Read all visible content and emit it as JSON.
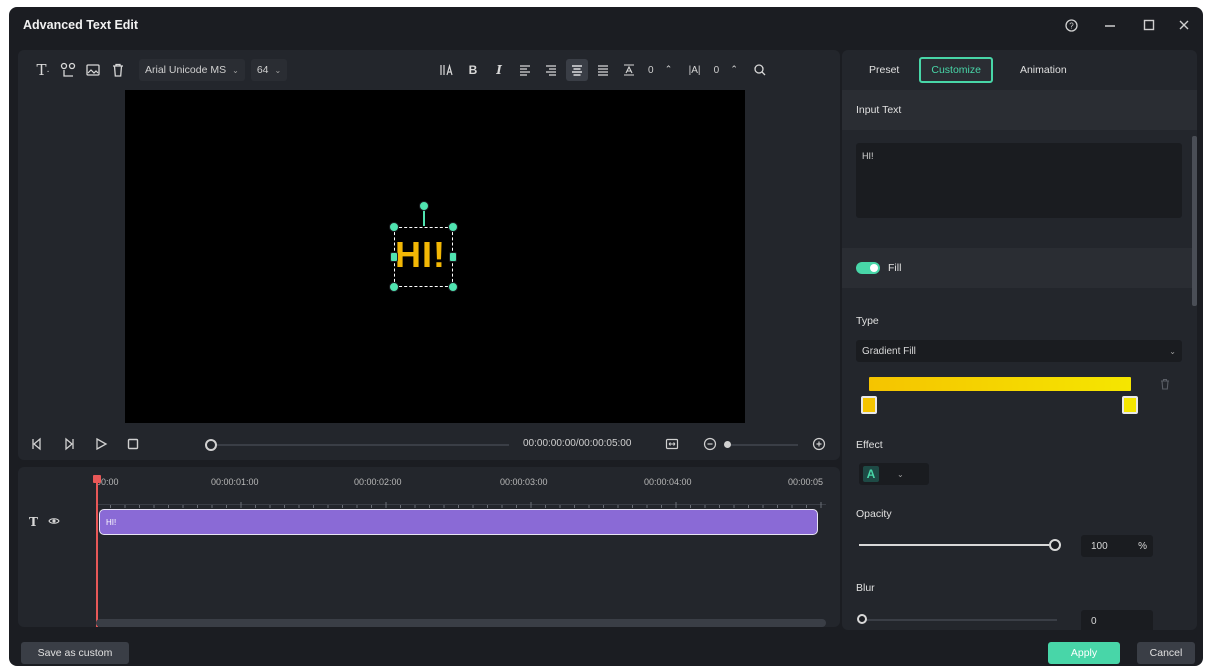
{
  "window": {
    "title": "Advanced Text Edit",
    "help_icon": "help-circle-icon",
    "minimize_icon": "minimize-icon",
    "maximize_icon": "maximize-icon",
    "close_icon": "close-icon"
  },
  "toolbar": {
    "font": "Arial Unicode MS",
    "font_size": "64",
    "line_spacing": "0",
    "char_spacing": "0"
  },
  "preview": {
    "text": "HI!",
    "text_color": "#f2b705"
  },
  "playback": {
    "timecode": "00:00:00:00/00:00:05:00"
  },
  "timeline": {
    "ruler": [
      "00:00",
      "00:00:01:00",
      "00:00:02:00",
      "00:00:03:00",
      "00:00:04:00",
      "00:00:05"
    ],
    "clip_label": "HI!",
    "clip_color": "#8a6ad6"
  },
  "tabs": [
    {
      "label": "Preset"
    },
    {
      "label": "Customize"
    },
    {
      "label": "Animation"
    }
  ],
  "panel": {
    "input_text_header": "Input Text",
    "input_text_value": "HI!",
    "fill_label": "Fill",
    "fill_enabled": true,
    "type_label": "Type",
    "type_value": "Gradient Fill",
    "gradient_start": "#f5c400",
    "gradient_end": "#f5e600",
    "effect_label": "Effect",
    "effect_glyph": "A",
    "opacity_label": "Opacity",
    "opacity_value": "100",
    "opacity_unit": "%",
    "blur_label": "Blur",
    "blur_value": "0"
  },
  "footer": {
    "save_custom": "Save as custom",
    "apply": "Apply",
    "cancel": "Cancel"
  },
  "accent_color": "#48d6a8"
}
